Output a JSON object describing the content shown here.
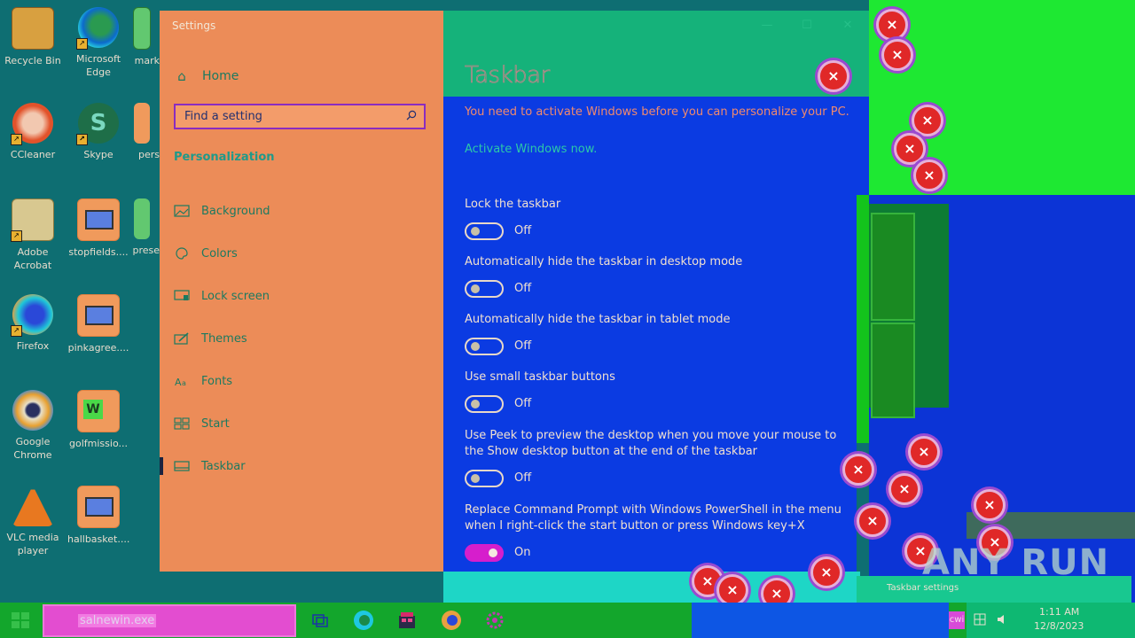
{
  "desktop": {
    "icons": [
      {
        "label": "Recycle Bin"
      },
      {
        "label": "Microsoft Edge"
      },
      {
        "label": "mark"
      },
      {
        "label": "CCleaner"
      },
      {
        "label": "Skype"
      },
      {
        "label": "pers"
      },
      {
        "label": "Adobe Acrobat"
      },
      {
        "label": "stopfields...."
      },
      {
        "label": "prese"
      },
      {
        "label": "Firefox"
      },
      {
        "label": "pinkagree...."
      },
      {
        "label": "Google Chrome"
      },
      {
        "label": "golfmissio..."
      },
      {
        "label": "VLC media player"
      },
      {
        "label": "hallbasket...."
      }
    ]
  },
  "settings": {
    "window_title": "Settings",
    "home_label": "Home",
    "search_placeholder": "Find a setting",
    "section_heading": "Personalization",
    "nav": [
      {
        "label": "Background",
        "icon": "image-icon"
      },
      {
        "label": "Colors",
        "icon": "palette-icon"
      },
      {
        "label": "Lock screen",
        "icon": "monitor-icon"
      },
      {
        "label": "Themes",
        "icon": "brush-icon"
      },
      {
        "label": "Fonts",
        "icon": "font-icon"
      },
      {
        "label": "Start",
        "icon": "start-grid-icon"
      },
      {
        "label": "Taskbar",
        "icon": "taskbar-icon"
      }
    ],
    "active_nav": "Taskbar",
    "page_title": "Taskbar",
    "activation_message": "You need to activate Windows before you can personalize your PC.",
    "activate_link": "Activate Windows now.",
    "settings": [
      {
        "label": "Lock the taskbar",
        "state": "Off",
        "on": false
      },
      {
        "label": "Automatically hide the taskbar in desktop mode",
        "state": "Off",
        "on": false
      },
      {
        "label": "Automatically hide the taskbar in tablet mode",
        "state": "Off",
        "on": false
      },
      {
        "label": "Use small taskbar buttons",
        "state": "Off",
        "on": false
      },
      {
        "label": "Use Peek to preview the desktop when you move your mouse to the Show desktop button at the end of the taskbar",
        "state": "Off",
        "on": false
      },
      {
        "label": "Replace Command Prompt with Windows PowerShell in the menu when I right-click the start button or press Windows key+X",
        "state": "On",
        "on": true
      }
    ]
  },
  "overlay": {
    "watermark": "ANY RUN",
    "tooltip": "Taskbar settings"
  },
  "taskbar": {
    "search_text": "salnewin.exe",
    "label": "cwi",
    "clock_time": "1:11 AM",
    "clock_date": "12/8/2023",
    "colors": {
      "accent": "#13a62c",
      "search_bg": "#e34dd0"
    }
  }
}
